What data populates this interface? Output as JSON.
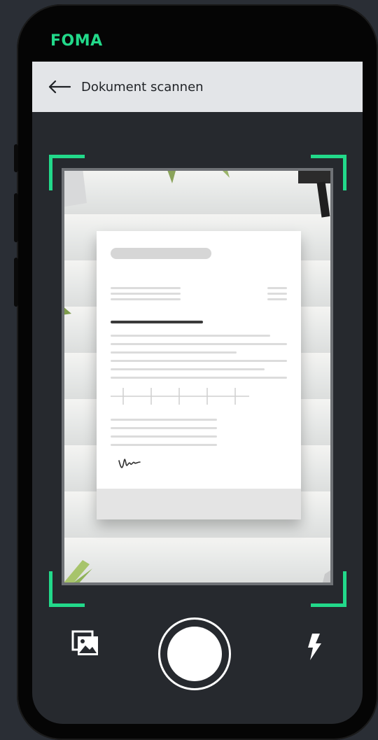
{
  "brand": {
    "name": "FOMA",
    "color": "#22d98a"
  },
  "appbar": {
    "back_icon": "arrow-left-icon",
    "title": "Dokument scannen"
  },
  "scanner": {
    "frame_color": "#22d98a",
    "document": {
      "signature_icon": "signature-icon"
    }
  },
  "controls": {
    "gallery_icon": "gallery-icon",
    "shutter_icon": "shutter-button",
    "flash_icon": "flash-icon"
  }
}
